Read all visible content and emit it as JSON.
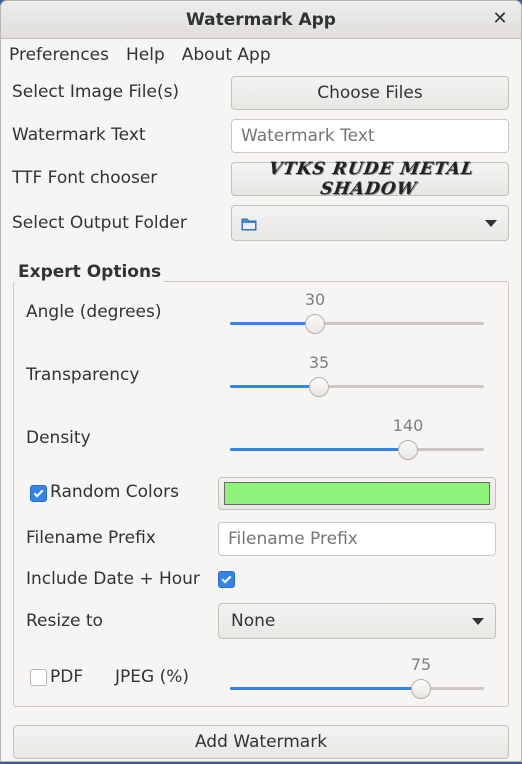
{
  "window": {
    "title": "Watermark App"
  },
  "menu": {
    "items": [
      "Preferences",
      "Help",
      "About App"
    ]
  },
  "form": {
    "select_images_label": "Select Image File(s)",
    "choose_files_label": "Choose Files",
    "watermark_text_label": "Watermark Text",
    "watermark_text_placeholder": "Watermark Text",
    "watermark_text_value": "",
    "font_chooser_label": "TTF Font chooser",
    "font_chooser_value": "VTKS RUDE METAL SHADOW",
    "output_folder_label": "Select Output Folder",
    "output_folder_value": ""
  },
  "expert": {
    "title": "Expert Options",
    "angle": {
      "label": "Angle (degrees)",
      "value": "30",
      "fraction": 0.333
    },
    "transparency": {
      "label": "Transparency",
      "value": "35",
      "fraction": 0.35
    },
    "density": {
      "label": "Density",
      "value": "140",
      "fraction": 0.7
    },
    "random_colors": {
      "label": "Random Colors",
      "checked": true,
      "color": "#8ff27a"
    },
    "filename_prefix": {
      "label": "Filename Prefix",
      "placeholder": "Filename Prefix",
      "value": ""
    },
    "include_date": {
      "label": "Include Date + Hour",
      "checked": true
    },
    "resize": {
      "label": "Resize to",
      "value": "None"
    },
    "pdf": {
      "label": "PDF",
      "checked": false
    },
    "jpeg": {
      "label": "JPEG (%)",
      "value": "75",
      "fraction": 0.75
    }
  },
  "actions": {
    "add_watermark_label": "Add Watermark"
  },
  "colors": {
    "accent": "#3584e4",
    "window_bg": "#f6f5f4",
    "desktop_bg": "#3a5fa0"
  },
  "icons": {
    "close": "close-icon",
    "folder": "folder-icon",
    "dropdown": "chevron-down-icon",
    "check": "check-icon"
  }
}
